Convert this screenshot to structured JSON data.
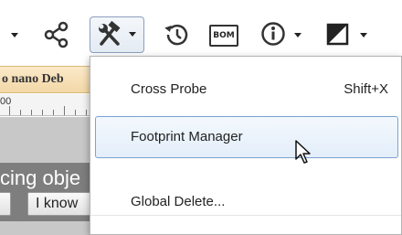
{
  "window": {
    "title_fragment": "o nano Deb",
    "ruler_label": "00",
    "hint_text": "cing obje",
    "hint_button_1_label": "",
    "hint_button_2_label": "I know"
  },
  "toolbar": {
    "items": [
      {
        "icon": "chevron-down-icon"
      },
      {
        "icon": "share-icon"
      },
      {
        "icon": "tools-icon",
        "has_dropdown": true,
        "active": true
      },
      {
        "icon": "history-icon"
      },
      {
        "icon": "bom-icon",
        "label": "BOM"
      },
      {
        "icon": "info-icon",
        "has_dropdown": true
      },
      {
        "icon": "contrast-icon",
        "has_dropdown": true
      }
    ]
  },
  "menu": {
    "items": [
      {
        "label": "Cross Probe",
        "shortcut": "Shift+X",
        "hovered": false
      },
      {
        "label": "Footprint Manager",
        "shortcut": "",
        "hovered": true
      },
      {
        "label": "Global Delete...",
        "shortcut": "",
        "hovered": false
      }
    ]
  },
  "colors": {
    "menu_hover_border": "#7da2ce",
    "menu_hover_bg": "#e3eefa",
    "title_strip_bg": "#f3d8a7",
    "hint_bar_bg": "#7e7e7e"
  }
}
